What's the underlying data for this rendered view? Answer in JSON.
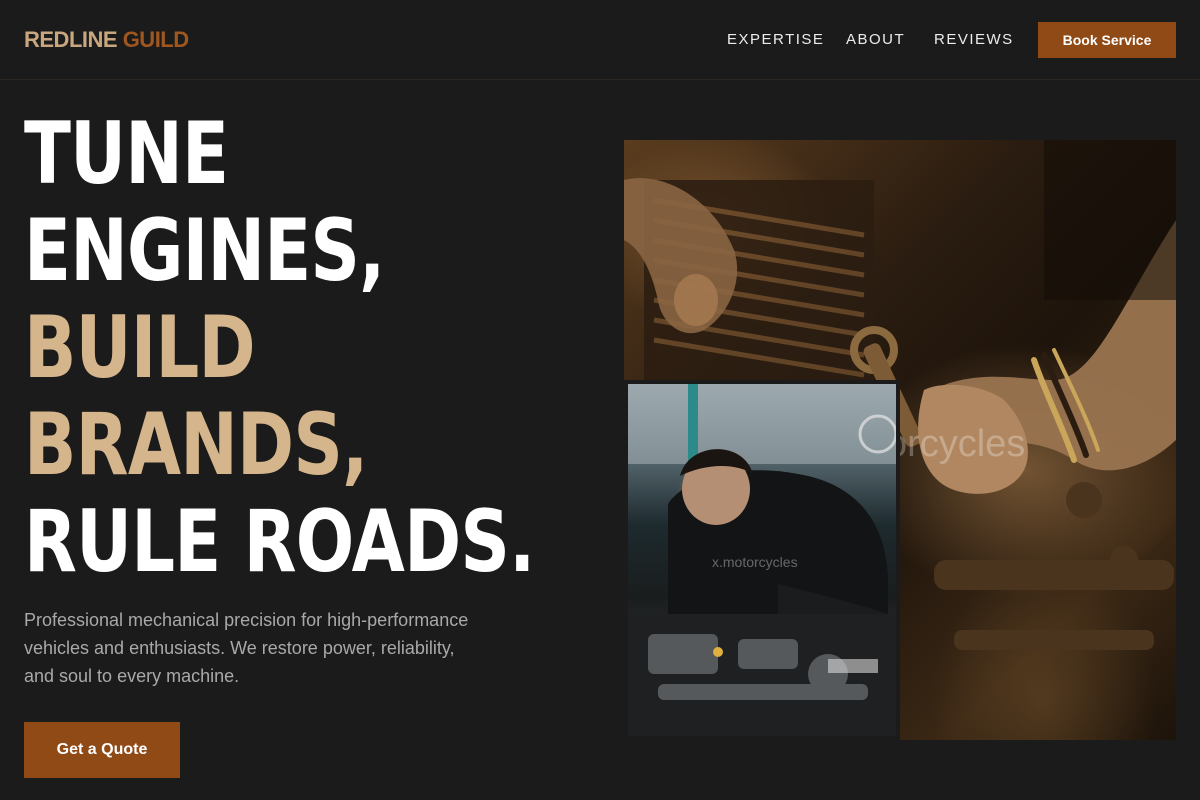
{
  "header": {
    "logo_part1": "REDLINE",
    "logo_part2": "GUILD",
    "nav": {
      "expertise": "EXPERTISE",
      "about": "ABOUT",
      "reviews": "REVIEWS"
    },
    "cta_label": "Book Service"
  },
  "hero": {
    "title_lines": [
      "TUNE",
      "ENGINES,",
      "BUILD",
      "BRANDS,",
      "RULE ROADS."
    ],
    "description": "Professional mechanical precision for high-performance vehicles and enthusiasts. We restore power, reliability, and soul to every machine.",
    "cta_label": "Get a Quote"
  },
  "images": {
    "large": {
      "subject": "hands tightening engine bolt with wrench",
      "watermark": "orcycles"
    },
    "small": {
      "subject": "mechanic working on car engine bay",
      "watermark": "x.motorcycles"
    }
  },
  "colors": {
    "background": "#1b1b1b",
    "accent": "#8f4a16",
    "tan": "#d5b58b",
    "text_muted": "#a9a9a9"
  }
}
